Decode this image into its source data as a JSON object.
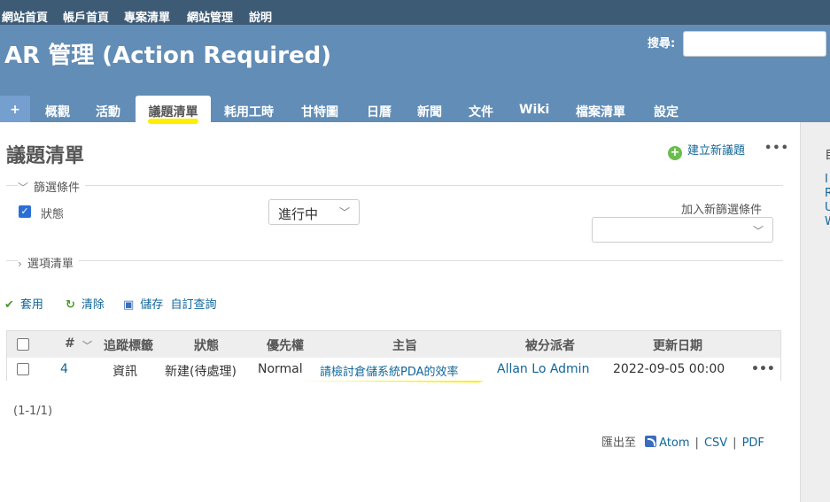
{
  "top_menu": [
    "網站首頁",
    "帳戶首頁",
    "專案清單",
    "網站管理",
    "說明"
  ],
  "header": {
    "project_title": "AR 管理 (Action Required)",
    "search_label": "搜尋:",
    "search_value": ""
  },
  "tabs": [
    {
      "label": "+",
      "selected": false
    },
    {
      "label": "概觀",
      "selected": false
    },
    {
      "label": "活動",
      "selected": false
    },
    {
      "label": "議題清單",
      "selected": true
    },
    {
      "label": "耗用工時",
      "selected": false
    },
    {
      "label": "甘特圖",
      "selected": false
    },
    {
      "label": "日曆",
      "selected": false
    },
    {
      "label": "新聞",
      "selected": false
    },
    {
      "label": "文件",
      "selected": false
    },
    {
      "label": "Wiki",
      "selected": false
    },
    {
      "label": "檔案清單",
      "selected": false
    },
    {
      "label": "設定",
      "selected": false
    }
  ],
  "content": {
    "page_title": "議題清單",
    "new_issue_label": "建立新議題",
    "more_menu": "•••",
    "filters_legend": "篩選條件",
    "filter_status_label": "狀態",
    "filter_status_checked": true,
    "filter_operator": "進行中",
    "add_filter_label": "加入新篩選條件",
    "options_legend": "選項清單",
    "apply_label": "套用",
    "clear_label": "清除",
    "save_label": "儲存",
    "custom_query_label": "自訂查詢"
  },
  "table": {
    "headers": [
      "#",
      "追蹤標籤",
      "狀態",
      "優先權",
      "主旨",
      "被分派者",
      "更新日期"
    ],
    "rows": [
      {
        "id": "4",
        "tracker": "資訊",
        "status": "新建(待處理)",
        "priority": "Normal",
        "subject": "請檢討倉儲系統PDA的效率",
        "assignee": "Allan Lo Admin",
        "updated": "2022-09-05 00:00"
      }
    ]
  },
  "pagination": "(1-1/1)",
  "export": {
    "label": "匯出至",
    "formats": [
      "Atom",
      "CSV",
      "PDF"
    ]
  },
  "sidebar": {
    "title_char": "自",
    "link_chars": [
      "I",
      "R",
      "U",
      "W"
    ]
  },
  "colors": {
    "top_menu_bg": "#3e5b76",
    "header_bg": "#628db6",
    "link": "#169",
    "highlight": "#ffee00"
  }
}
